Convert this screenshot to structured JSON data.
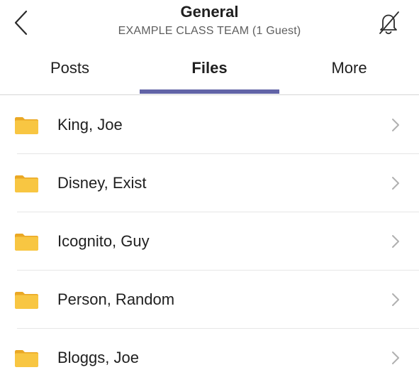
{
  "header": {
    "title": "General",
    "subtitle": "EXAMPLE CLASS TEAM (1 Guest)",
    "back_icon": "chevron-left-icon",
    "notifications_icon": "bell-off-icon"
  },
  "tabs": [
    {
      "label": "Posts",
      "selected": false
    },
    {
      "label": "Files",
      "selected": true
    },
    {
      "label": "More",
      "selected": false
    }
  ],
  "colors": {
    "accent": "#6264a7",
    "folder": "#f8c642",
    "folder_tab": "#eaa825"
  },
  "files": {
    "items": [
      {
        "name": "King, Joe",
        "icon": "folder-icon"
      },
      {
        "name": "Disney, Exist",
        "icon": "folder-icon"
      },
      {
        "name": "Icognito, Guy",
        "icon": "folder-icon"
      },
      {
        "name": "Person, Random",
        "icon": "folder-icon"
      },
      {
        "name": "Bloggs, Joe",
        "icon": "folder-icon"
      }
    ]
  }
}
